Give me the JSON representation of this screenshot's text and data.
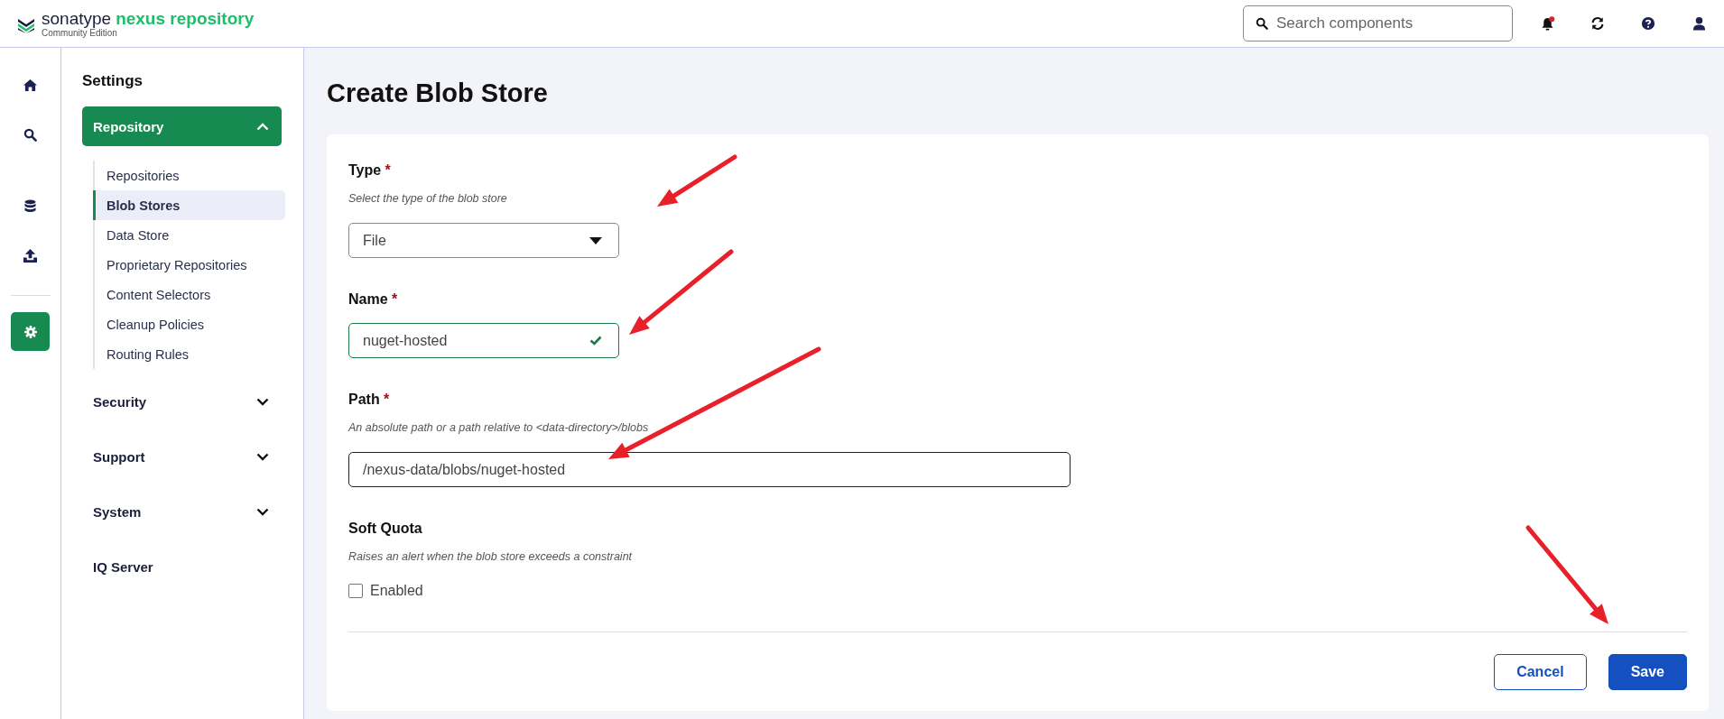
{
  "header": {
    "logo": {
      "brand": "sonatype",
      "product": "nexus repository",
      "edition": "Community Edition"
    },
    "search": {
      "placeholder": "Search components"
    },
    "notification_badge": true
  },
  "nav_rail": [
    {
      "kind": "home",
      "selected": false
    },
    {
      "kind": "search",
      "selected": false
    },
    {
      "kind": "database",
      "selected": false
    },
    {
      "kind": "upload",
      "selected": false
    },
    {
      "kind": "settings",
      "selected": true
    }
  ],
  "sidebar": {
    "title": "Settings",
    "sections": [
      {
        "kind": "group",
        "label": "Repository",
        "expanded": true,
        "children": [
          {
            "label": "Repositories",
            "selected": false
          },
          {
            "label": "Blob Stores",
            "selected": true
          },
          {
            "label": "Data Store",
            "selected": false
          },
          {
            "label": "Proprietary Repositories",
            "selected": false
          },
          {
            "label": "Content Selectors",
            "selected": false
          },
          {
            "label": "Cleanup Policies",
            "selected": false
          },
          {
            "label": "Routing Rules",
            "selected": false
          }
        ]
      },
      {
        "kind": "group",
        "label": "Security",
        "expanded": false
      },
      {
        "kind": "group",
        "label": "Support",
        "expanded": false
      },
      {
        "kind": "group",
        "label": "System",
        "expanded": false
      },
      {
        "kind": "link",
        "label": "IQ Server"
      }
    ]
  },
  "page": {
    "title": "Create Blob Store"
  },
  "form": {
    "fields": [
      {
        "kind": "select",
        "label": "Type",
        "required_mark": "*",
        "hint": "Select the type of the blob store",
        "value": "File"
      },
      {
        "kind": "text",
        "label": "Name",
        "required_mark": "*",
        "value": "nuget-hosted",
        "valid": true
      },
      {
        "kind": "text",
        "label": "Path",
        "required_mark": "*",
        "hint": "An absolute path or a path relative to <data-directory>/blobs",
        "value": "/nexus-data/blobs/nuget-hosted",
        "valid": false
      },
      {
        "kind": "checkbox",
        "label": "Soft Quota",
        "hint": "Raises an alert when the blob store exceeds a constraint",
        "option": "Enabled",
        "checked": false
      }
    ]
  },
  "buttons": [
    {
      "kind": "secondary",
      "label": "Cancel"
    },
    {
      "kind": "primary",
      "label": "Save"
    }
  ]
}
